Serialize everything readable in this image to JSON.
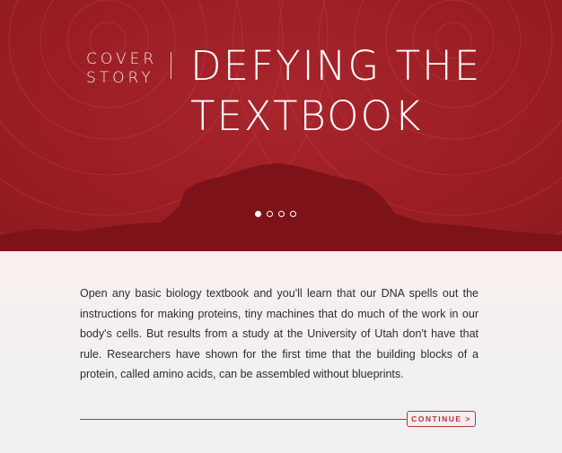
{
  "hero": {
    "kicker_line1": "COVER",
    "kicker_line2": "STORY",
    "title": "DEFYING THE TEXTBOOK",
    "slides": {
      "count": 4,
      "active": 1
    },
    "colors": {
      "background": "#9c1e25",
      "mountain": "#7d1218"
    }
  },
  "article": {
    "body": "Open any basic biology textbook and you'll learn that our DNA spells out the instructions for making proteins, tiny machines that do much of the work in our body's cells. But results from a study at the University of Utah don't have that rule. Researchers have shown for the first time that the building blocks of a protein, called amino acids, can be assembled without blueprints.",
    "continue_label": "CONTINUE >",
    "accent": "#b8343a"
  }
}
